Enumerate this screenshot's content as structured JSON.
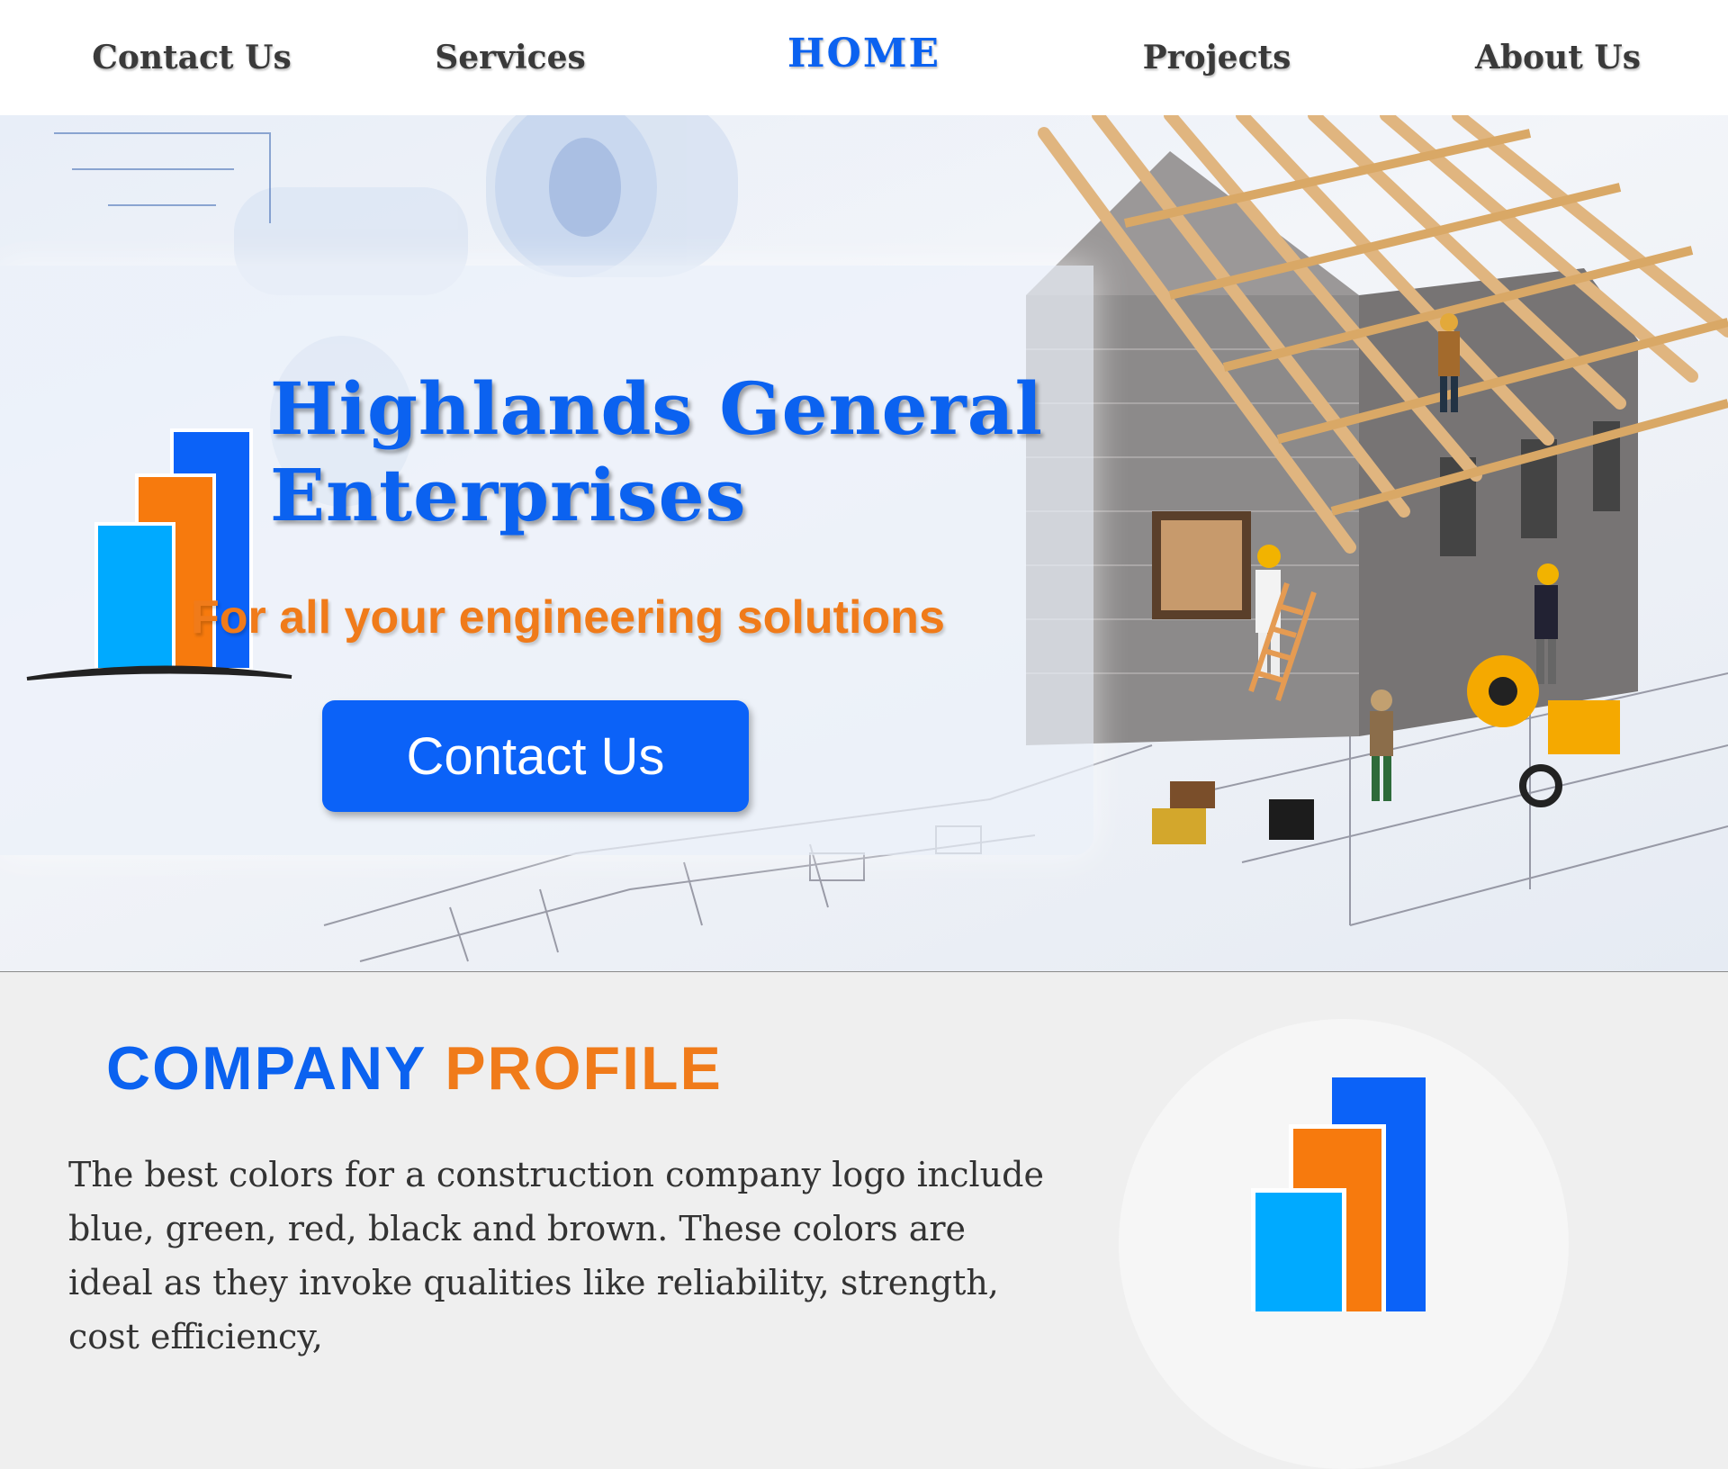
{
  "nav": {
    "items": [
      {
        "label": "Contact Us"
      },
      {
        "label": "Services"
      },
      {
        "label": "HOME",
        "active": true
      },
      {
        "label": "Projects"
      },
      {
        "label": "About Us"
      }
    ]
  },
  "hero": {
    "company_name_line1": "Highlands General",
    "company_name_line2": "Enterprises",
    "tagline": "For all your engineering solutions",
    "cta_label": "Contact Us"
  },
  "profile": {
    "heading_part1": "COMPANY",
    "heading_part2": "PROFILE",
    "text": "The best colors for a construction company logo include blue, green, red, black and brown. These colors are ideal as they invoke qualities like reliability, strength, cost efficiency,"
  },
  "colors": {
    "brand_blue": "#0b62f0",
    "brand_orange": "#f07b1a",
    "brand_light_blue": "#00aaff",
    "background": "#efefef"
  },
  "icons": {
    "logo": "bar-chart-logo",
    "hero_image": "house-construction-photo"
  }
}
